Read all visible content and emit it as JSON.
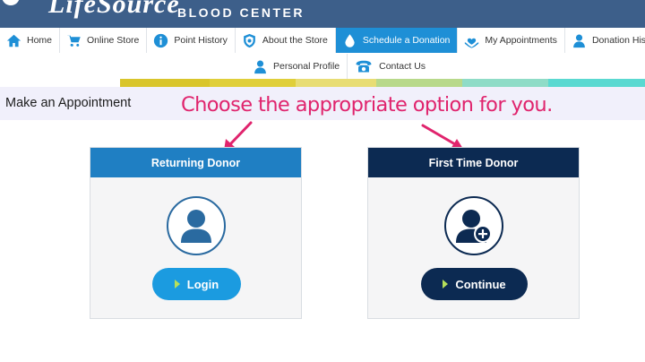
{
  "header": {
    "logo_text": "LifeSource",
    "logo_subtitle": "BLOOD CENTER"
  },
  "nav": {
    "row1": [
      {
        "label": "Home",
        "icon": "home-icon"
      },
      {
        "label": "Online Store",
        "icon": "cart-icon"
      },
      {
        "label": "Point History",
        "icon": "info-icon"
      },
      {
        "label": "About the Store",
        "icon": "shield-icon"
      },
      {
        "label": "Schedule a Donation",
        "icon": "blood-drop-icon",
        "active": true
      },
      {
        "label": "My Appointments",
        "icon": "hand-heart-icon"
      },
      {
        "label": "Donation Hist",
        "icon": "person-icon"
      }
    ],
    "row2": [
      {
        "label": "Personal Profile",
        "icon": "person-icon"
      },
      {
        "label": "Contact Us",
        "icon": "phone-icon"
      }
    ]
  },
  "stripe_colors": [
    "#ffffff",
    "#d9c52b",
    "#e0cf3a",
    "#e8dd74",
    "#b8d98a",
    "#8fdcc7",
    "#5ad9d1"
  ],
  "page_title": "Make an Appointment",
  "annotation": "Choose the appropriate option for you.",
  "annotation_color": "#e0246d",
  "cards": {
    "returning": {
      "title": "Returning Donor",
      "icon": "user-icon",
      "button": "Login"
    },
    "first_time": {
      "title": "First Time Donor",
      "icon": "user-add-icon",
      "button": "Continue"
    }
  }
}
